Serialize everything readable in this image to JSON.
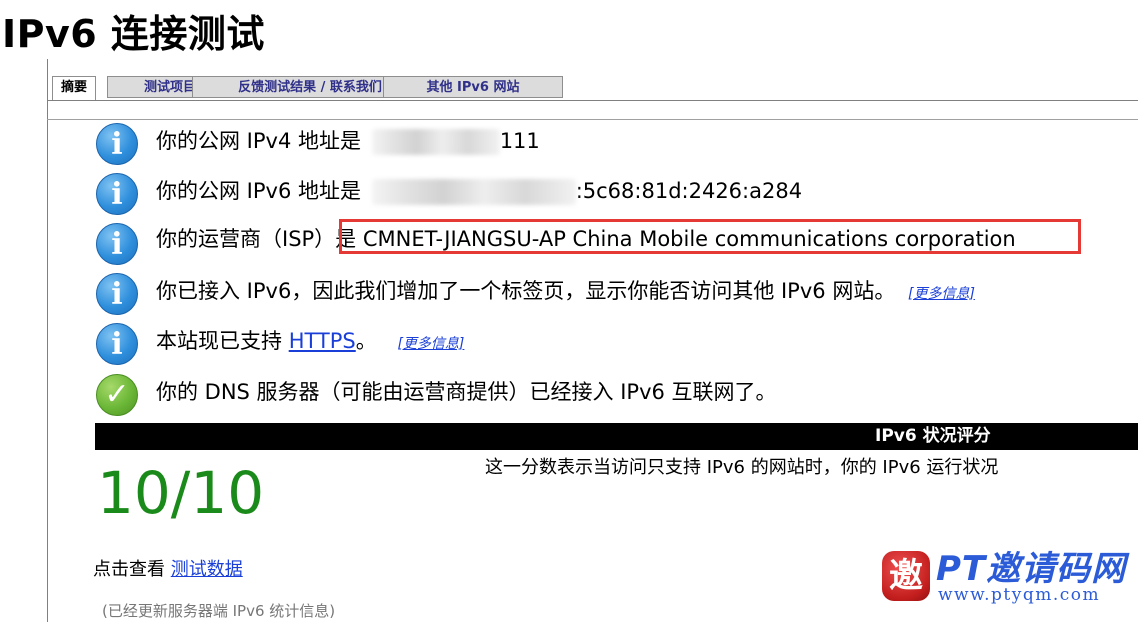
{
  "page": {
    "title": "IPv6 连接测试"
  },
  "tabs": [
    {
      "label": "摘要",
      "active": true
    },
    {
      "label": "测试项目",
      "active": false
    },
    {
      "label": "反馈测试结果 / 联系我们",
      "active": false
    },
    {
      "label": "其他 IPv6 网站",
      "active": false
    }
  ],
  "summary": {
    "ipv4_prefix": "你的公网 IPv4 地址是",
    "ipv4_suffix": "111",
    "ipv6_prefix": "你的公网 IPv6 地址是",
    "ipv6_suffix": ":5c68:81d:2426:a284",
    "isp_prefix": "你的运营商（ISP）是",
    "isp_value": "CMNET-JIANGSU-AP China Mobile communications corporation",
    "ipv6_tab_text": "你已接入 IPv6，因此我们增加了一个标签页，显示你能否访问其他 IPv6 网站。",
    "more_info": "[更多信息]",
    "https_prefix": "本站现已支持",
    "https_link": "HTTPS",
    "https_suffix": "。",
    "dns_text": "你的 DNS 服务器（可能由运营商提供）已经接入 IPv6 互联网了。"
  },
  "score": {
    "header": "IPv6 状况评分",
    "value": "10/10",
    "description": "这一分数表示当访问只支持 IPv6 的网站时，你的 IPv6 运行状况",
    "view_prefix": "点击查看",
    "view_link": "测试数据",
    "updated_note": "(已经更新服务器端 IPv6 统计信息)"
  },
  "watermark": {
    "badge_char": "邀",
    "title": "PT邀请码网",
    "url": "www.ptyqm.com"
  },
  "colors": {
    "score_green": "#1a8a1a",
    "isp_highlight": "#e53935",
    "link_blue": "#1a3fd8",
    "tab_inactive_text": "#30308a"
  }
}
